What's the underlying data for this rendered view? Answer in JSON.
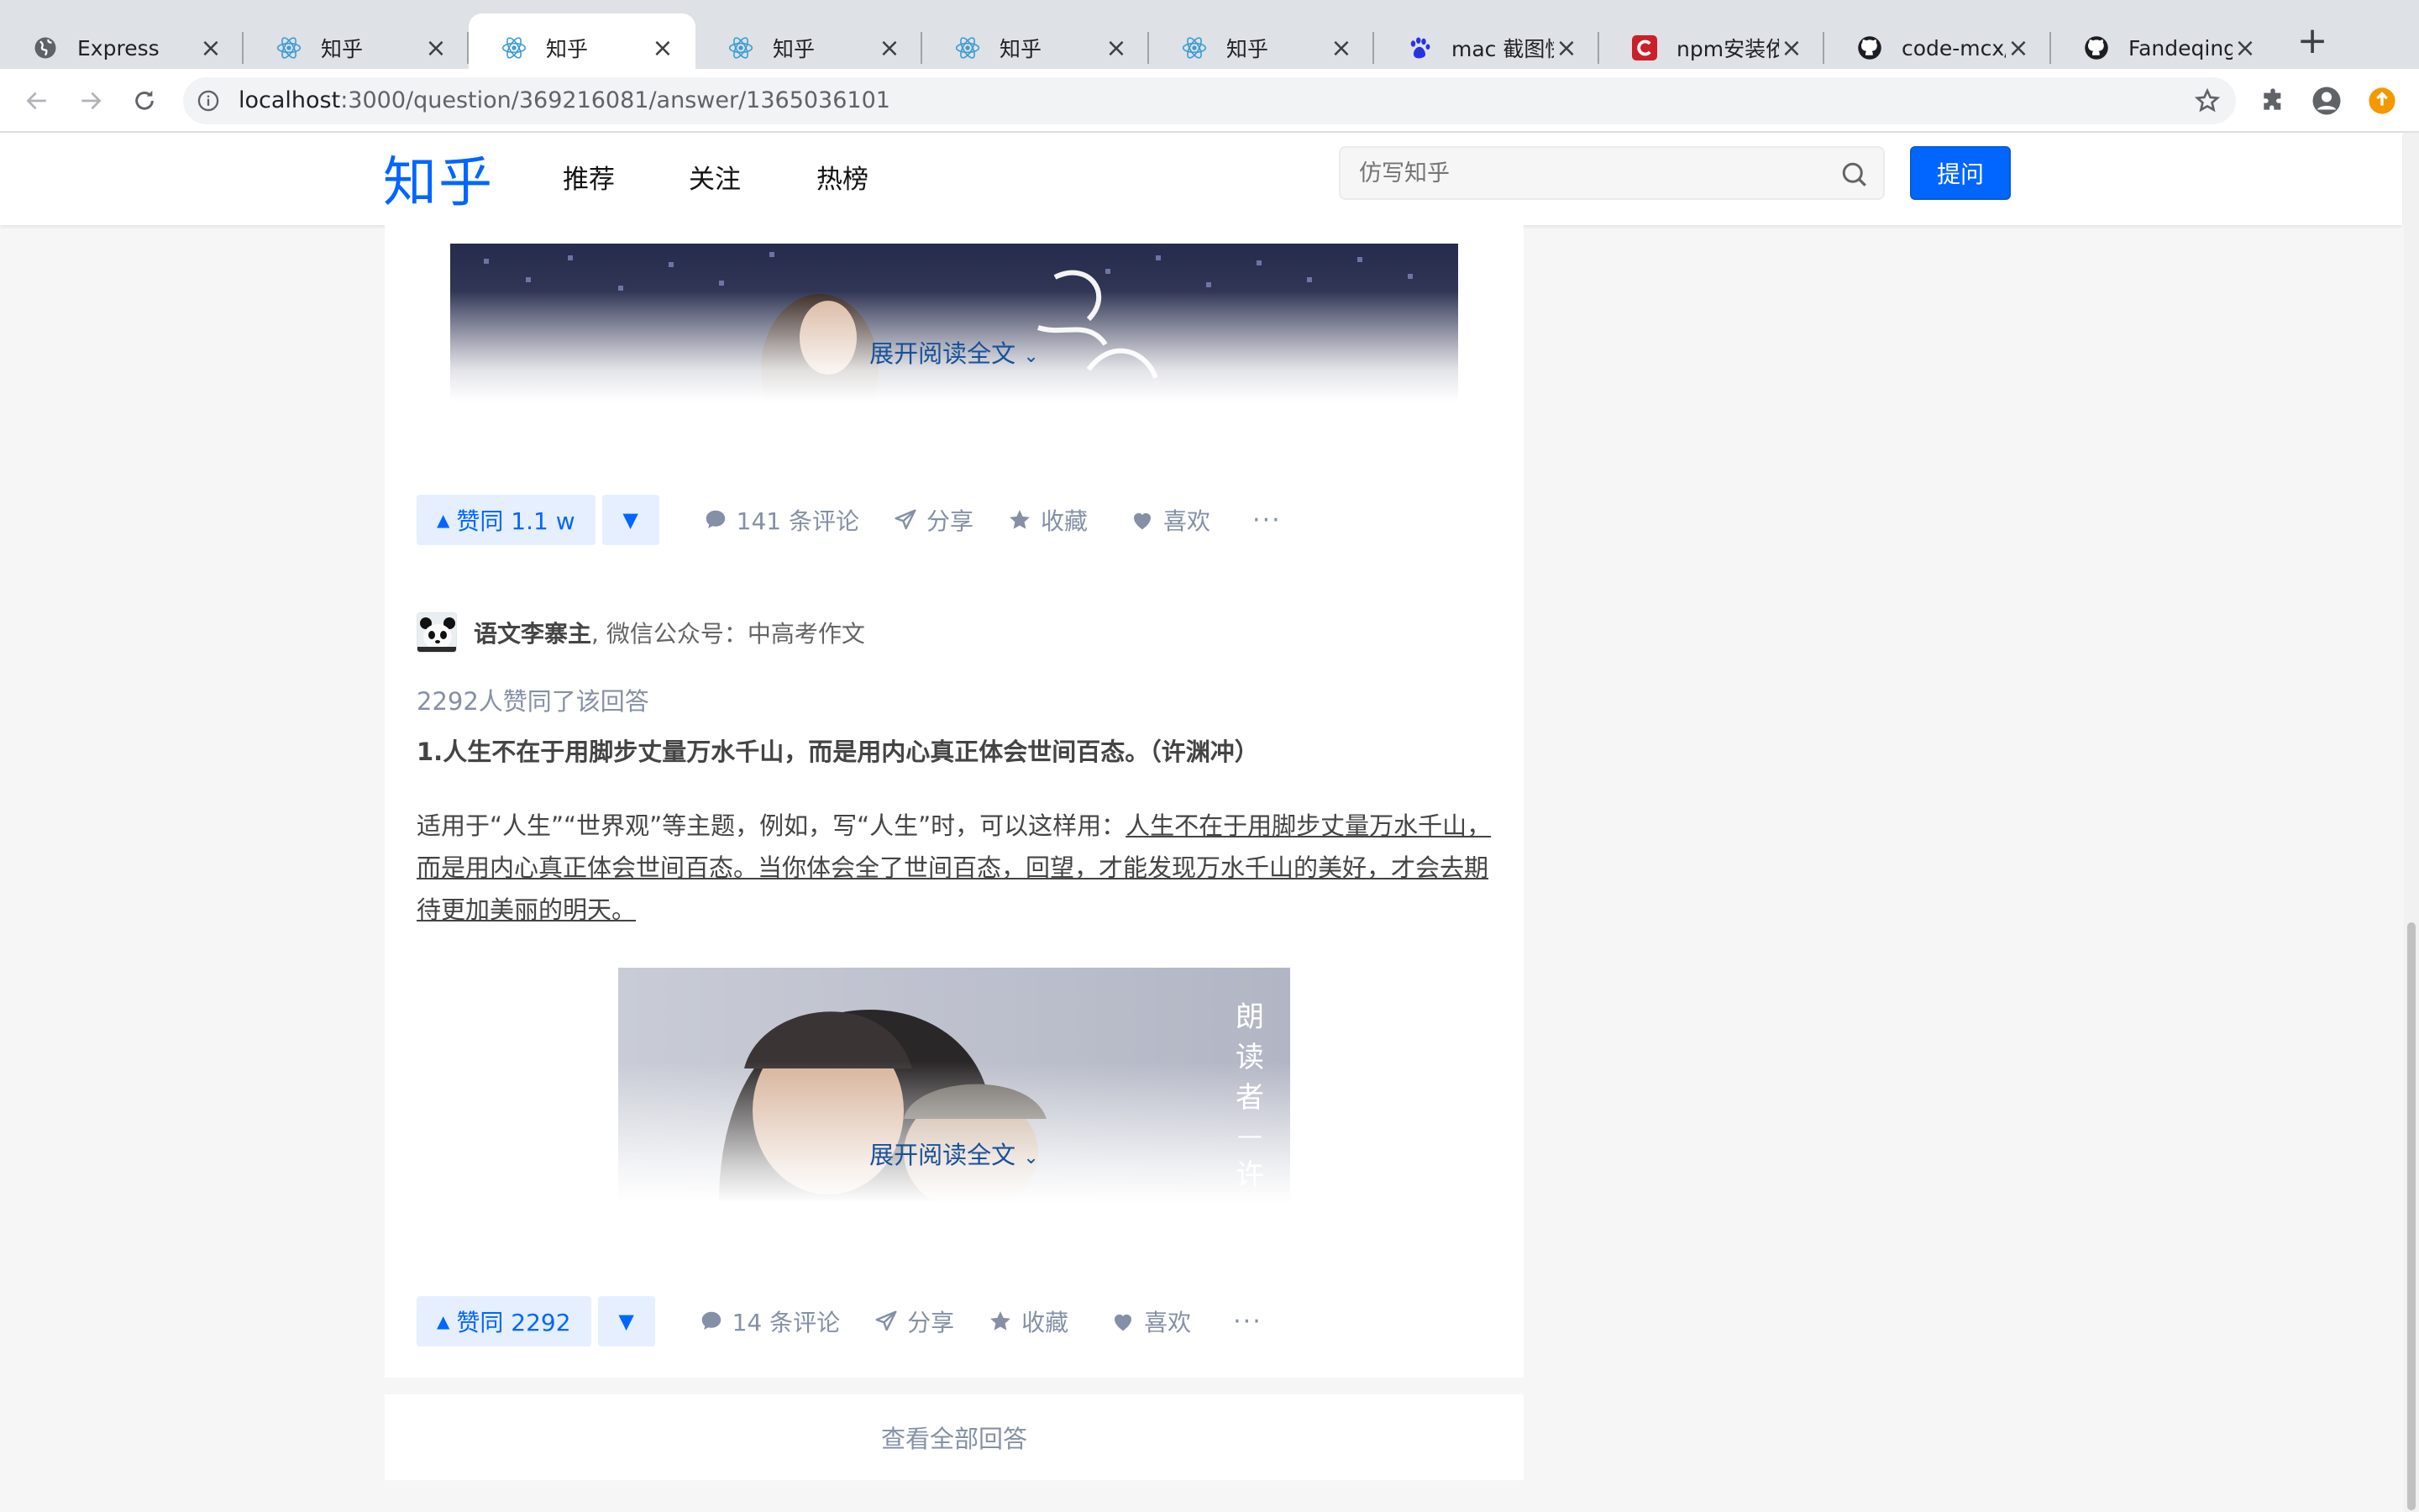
{
  "browser": {
    "tabs": [
      {
        "title": "Express",
        "icon": "globe-icon",
        "active": false
      },
      {
        "title": "知乎",
        "icon": "react-icon",
        "active": false
      },
      {
        "title": "知乎",
        "icon": "react-icon",
        "active": true
      },
      {
        "title": "知乎",
        "icon": "react-icon",
        "active": false
      },
      {
        "title": "知乎",
        "icon": "react-icon",
        "active": false
      },
      {
        "title": "知乎",
        "icon": "react-icon",
        "active": false
      },
      {
        "title": "mac 截图快捷",
        "icon": "baidu-paw-icon",
        "active": false
      },
      {
        "title": "npm安装依赖",
        "icon": "c-logo-icon",
        "active": false
      },
      {
        "title": "code-mcx/re",
        "icon": "github-icon",
        "active": false
      },
      {
        "title": "Fandeqing/re",
        "icon": "github-icon",
        "active": false
      }
    ],
    "url_host": "localhost",
    "url_path": ":3000/question/369216081/answer/1365036101"
  },
  "header": {
    "logo": "知乎",
    "nav": [
      "推荐",
      "关注",
      "热榜"
    ],
    "search_placeholder": "仿写知乎",
    "ask_label": "提问"
  },
  "answers": [
    {
      "expand_label": "展开阅读全文",
      "upvote_label": "赞同 1.1 w",
      "comments_label": "141 条评论",
      "share_label": "分享",
      "collect_label": "收藏",
      "like_label": "喜欢"
    },
    {
      "author_name": "语文李寨主",
      "author_bio": ", 微信公众号：中高考作文",
      "voters_text": "2292人赞同了该回答",
      "heading": "1.人生不在于用脚步丈量万水千山，而是用内心真正体会世间百态。（许渊冲）",
      "body_prefix": "适用于“人生”“世界观”等主题，例如，写“人生”时，可以这样用：",
      "body_quote": "人生不在于用脚步丈量万水千山，而是用内心真正体会世间百态。当你体会全了世间百态，回望，才能发现万水千山的美好，才会去期待更加美丽的明天。",
      "image_caption": "朗读者 — 许渊",
      "expand_label": "展开阅读全文",
      "upvote_label": "赞同 2292",
      "comments_label": "14 条评论",
      "share_label": "分享",
      "collect_label": "收藏",
      "like_label": "喜欢"
    }
  ],
  "view_all_label": "查看全部回答",
  "colors": {
    "brand": "#0066ff",
    "link": "#175199",
    "muted": "#8590a6"
  }
}
